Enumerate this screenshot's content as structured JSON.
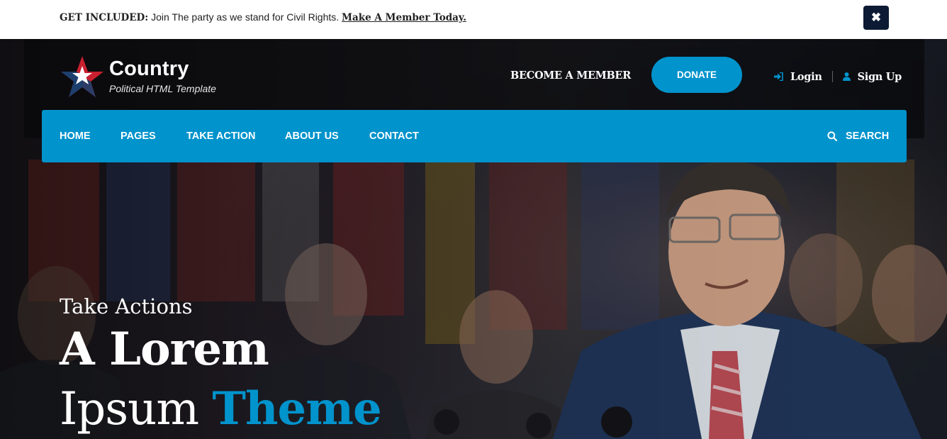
{
  "announcement": {
    "lead": "GET INCLUDED:",
    "text": " Join The party as we stand for Civil Rights. ",
    "link": "Make A Member Today.",
    "close_icon": "close-icon"
  },
  "header": {
    "logo": {
      "name": "Country",
      "tagline": "Political HTML Template",
      "icon": "star-logo-icon"
    },
    "become_member": "BECOME A MEMBER",
    "donate": "DONATE",
    "login": "Login",
    "signup": "Sign Up",
    "login_icon": "sign-in-icon",
    "signup_icon": "user-icon"
  },
  "nav": {
    "items": [
      "HOME",
      "PAGES",
      "TAKE ACTION",
      "ABOUT US",
      "CONTACT"
    ],
    "search": "SEARCH",
    "search_icon": "search-icon"
  },
  "hero": {
    "kicker": "Take Actions",
    "headline_line1": "A Lorem",
    "headline_line2_prefix": "Ipsum ",
    "headline_line2_accent": "Theme"
  },
  "colors": {
    "accent": "#0193cc",
    "close_button": "#0c1a33",
    "logo_red": "#c8202f",
    "logo_blue": "#1c3f6e"
  }
}
